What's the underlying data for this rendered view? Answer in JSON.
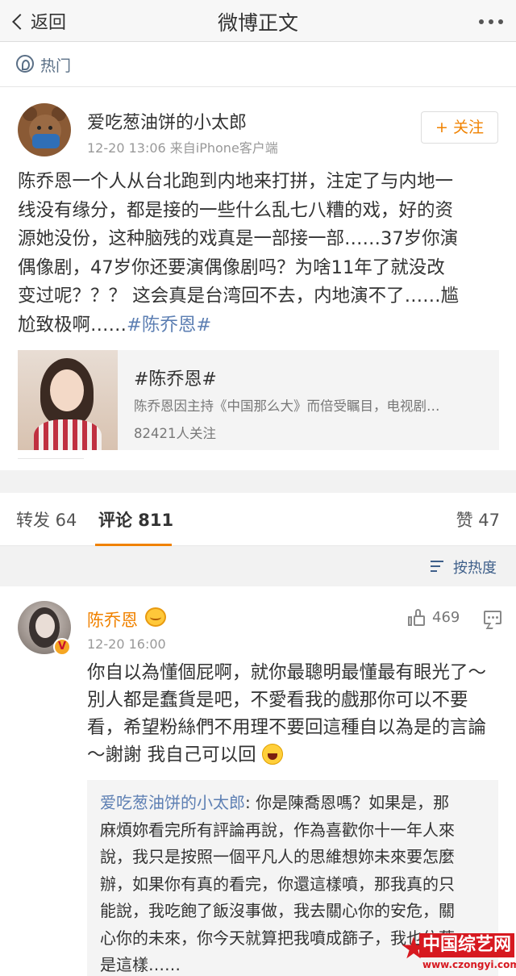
{
  "nav": {
    "back_label": "返回",
    "title": "微博正文"
  },
  "hot": {
    "label": "热门"
  },
  "post": {
    "author": "爱吃葱油饼的小太郎",
    "time": "12-20 13:06",
    "source": "来自iPhone客户端",
    "follow_label": "+ 关注",
    "text_lines": [
      "陈乔恩一个人从台北跑到内地来打拼，注定了与内地一",
      "线没有缘分，都是接的一些什么乱七八糟的戏，好的资",
      "源她没份，这种脑残的戏真是一部接一部……37岁你演",
      "偶像剧，47岁你还要演偶像剧吗？为啥11年了就没改",
      "变过呢？？？ 这会真是台湾回不去，内地演不了……尴",
      "尬致极啊……"
    ],
    "topic_tag": "#陈乔恩#"
  },
  "topic_card": {
    "title": "#陈乔恩#",
    "desc": "陈乔恩因主持《中国那么大》而倍受瞩目，电视剧…",
    "followers": "82421人关注"
  },
  "tabs": {
    "repost": "转发 64",
    "comment": "评论 811",
    "like": "赞 47"
  },
  "sort": {
    "label": "按热度"
  },
  "comment": {
    "author": "陈乔恩",
    "time": "12-20 16:00",
    "likes": "469",
    "verified_badge": "V",
    "text_lines": [
      "你自以為懂個屁啊，就你最聰明最懂最有眼光了～",
      "別人都是蠢貨是吧，不愛看我的戲那你可以不要",
      "看，希望粉絲們不用理不要回這種自以為是的言論",
      "～謝謝 我自己可以回"
    ],
    "quote": {
      "author": "爱吃葱油饼的小太郎",
      "text_first": ": 你是陳喬恩嗎？如果是，那",
      "text_lines": [
        "麻煩妳看完所有評論再說，作為喜歡你十一年人來",
        "說，我只是按照一個平凡人的思維想妳未來要怎麼",
        "辦，如果你有真的看完，你還這樣噴，那我真的只",
        "能說，我吃飽了飯沒事做，我去關心你的安危，關",
        "心你的未來，你今天就算把我噴成篩子，我也依舊",
        "是這樣……"
      ]
    }
  },
  "watermark": {
    "title": "中国综艺网",
    "url": "www.czongyi.com"
  },
  "colors": {
    "accent_orange": "#f08200",
    "link_blue": "#5d7fb3",
    "brand_red": "#d71920"
  }
}
